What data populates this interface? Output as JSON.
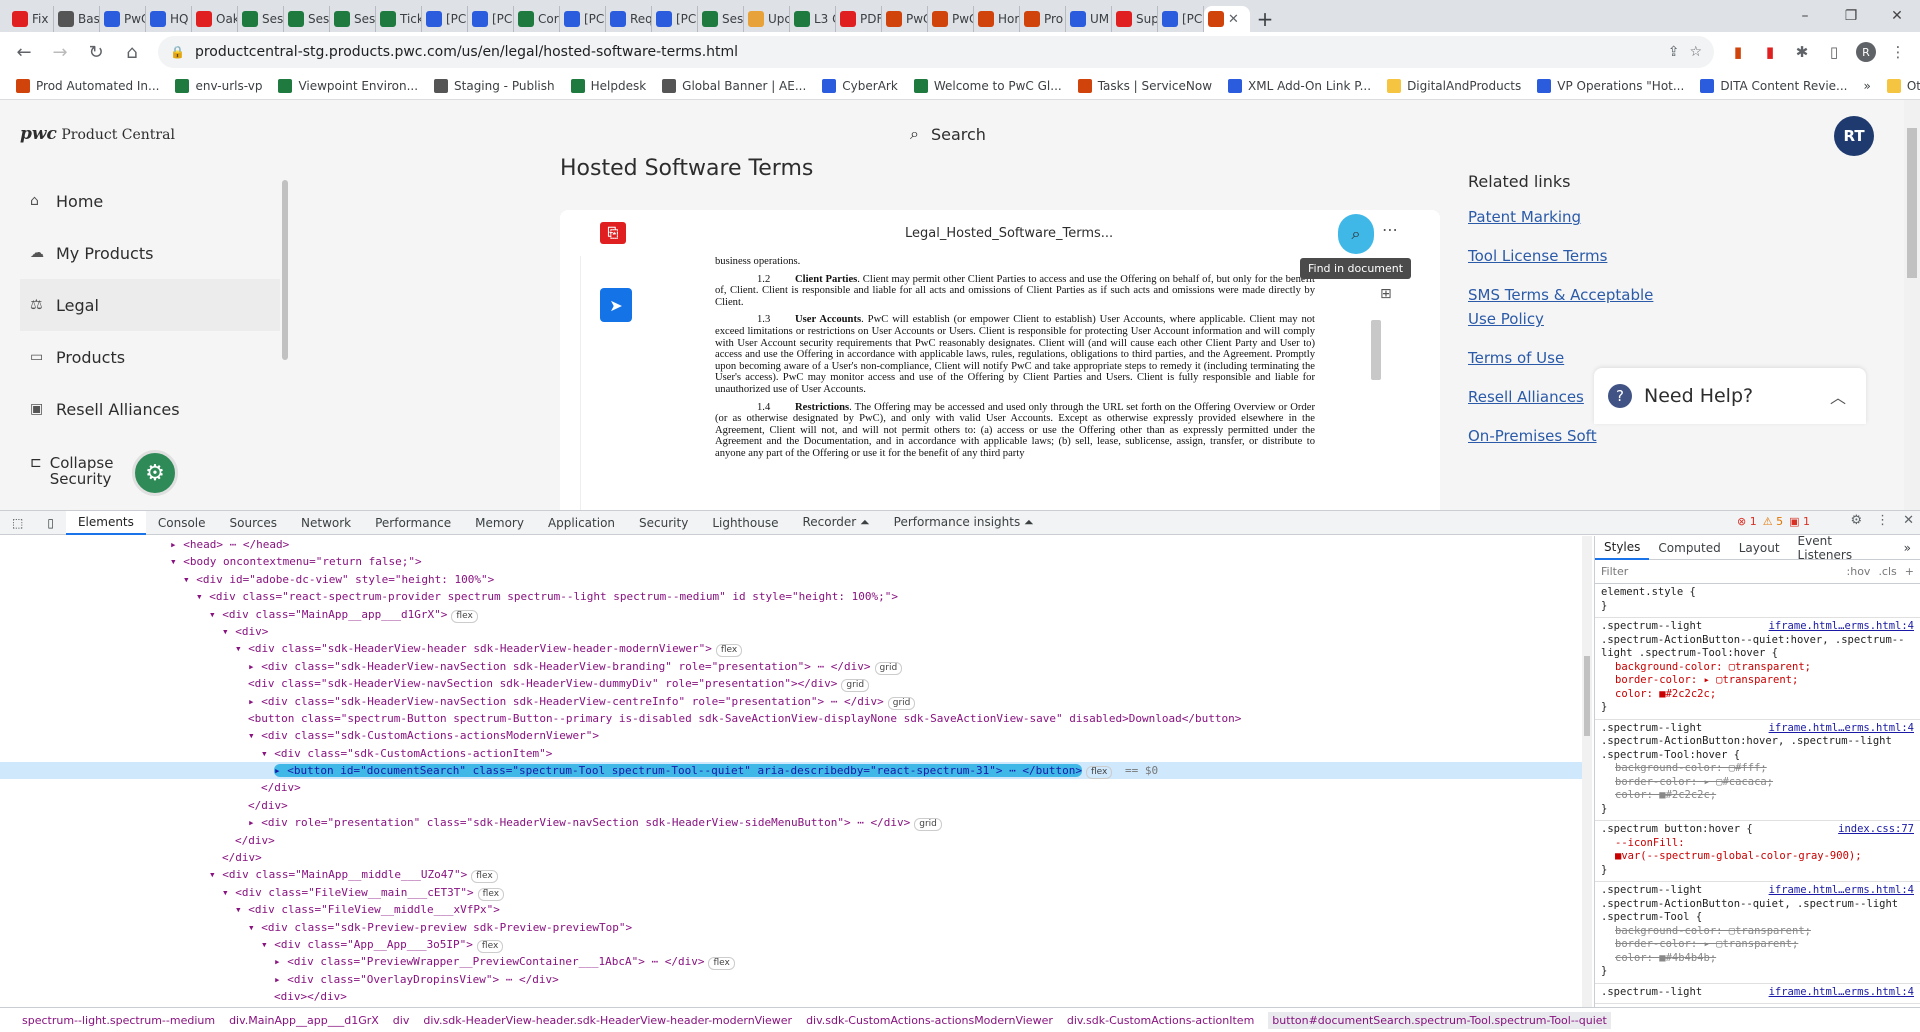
{
  "browser": {
    "tabs": [
      {
        "label": "Fix",
        "color": "#e02020"
      },
      {
        "label": "Bas",
        "color": "#555"
      },
      {
        "label": "PwC",
        "color": "#2b5cde"
      },
      {
        "label": "HQ",
        "color": "#2b5cde"
      },
      {
        "label": "Oak",
        "color": "#e02020"
      },
      {
        "label": "Ses",
        "color": "#1e7a3e"
      },
      {
        "label": "Ses",
        "color": "#1e7a3e"
      },
      {
        "label": "Ses",
        "color": "#1e7a3e"
      },
      {
        "label": "Tick",
        "color": "#1e7a3e"
      },
      {
        "label": "[PC",
        "color": "#2b5cde"
      },
      {
        "label": "[PC",
        "color": "#2b5cde"
      },
      {
        "label": "Cor",
        "color": "#1e7a3e"
      },
      {
        "label": "[PC",
        "color": "#2b5cde"
      },
      {
        "label": "Req",
        "color": "#2b5cde"
      },
      {
        "label": "[PC",
        "color": "#2b5cde"
      },
      {
        "label": "Ses",
        "color": "#1e7a3e"
      },
      {
        "label": "Upc",
        "color": "#e8a23a"
      },
      {
        "label": "L3 C",
        "color": "#1e7a3e"
      },
      {
        "label": "PDF",
        "color": "#e02020"
      },
      {
        "label": "PwC",
        "color": "#d0440c"
      },
      {
        "label": "PwC",
        "color": "#d0440c"
      },
      {
        "label": "Hor",
        "color": "#d0440c"
      },
      {
        "label": "Pro",
        "color": "#d0440c"
      },
      {
        "label": "UM",
        "color": "#2b5cde"
      },
      {
        "label": "Sup",
        "color": "#e02020"
      },
      {
        "label": "[PC",
        "color": "#2b5cde"
      }
    ],
    "active_tab_close": "✕",
    "url": "productcentral-stg.products.pwc.com/us/en/legal/hosted-software-terms.html",
    "profile_initial": "R",
    "bookmarks": [
      {
        "label": "Prod Automated In...",
        "color": "#d0440c"
      },
      {
        "label": "env-urls-vp",
        "color": "#1e7a3e"
      },
      {
        "label": "Viewpoint Environ...",
        "color": "#1e7a3e"
      },
      {
        "label": "Staging - Publish",
        "color": "#555"
      },
      {
        "label": "Helpdesk",
        "color": "#1e7a3e"
      },
      {
        "label": "Global Banner | AE...",
        "color": "#555"
      },
      {
        "label": "CyberArk",
        "color": "#2b5cde"
      },
      {
        "label": "Welcome to PwC Gl...",
        "color": "#1e7a3e"
      },
      {
        "label": "Tasks | ServiceNow",
        "color": "#d0440c"
      },
      {
        "label": "XML Add-On Link P...",
        "color": "#2b5cde"
      },
      {
        "label": "DigitalAndProducts",
        "color": "#f5c542"
      },
      {
        "label": "VP Operations \"Hot...",
        "color": "#2b5cde"
      },
      {
        "label": "DITA Content Revie...",
        "color": "#2b5cde"
      }
    ],
    "more_bookmarks": "»",
    "other_bookmarks": "Other bookmarks"
  },
  "site": {
    "logo_brand": "pwc",
    "logo_text": "Product Central",
    "search_label": "Search",
    "user_initials": "RT",
    "nav": [
      {
        "label": "Home",
        "icon": "home-icon",
        "glyph": "⌂"
      },
      {
        "label": "My Products",
        "icon": "cloud-icon",
        "glyph": "☁"
      },
      {
        "label": "Legal",
        "icon": "scale-icon",
        "glyph": "⚖"
      },
      {
        "label": "Products",
        "icon": "briefcase-icon",
        "glyph": "▭"
      },
      {
        "label": "Resell Alliances",
        "icon": "handshake-icon",
        "glyph": "▣"
      }
    ],
    "collapse_line1": "Collapse",
    "collapse_line2": "Security",
    "page_title": "Hosted Software Terms",
    "related_title": "Related links",
    "related_links": [
      "Patent Marking",
      "Tool License Terms",
      "SMS Terms & Acceptable Use Policy",
      "Terms of Use",
      "Resell Alliances",
      "On-Premises Soft"
    ],
    "need_help": "Need Help?"
  },
  "viewer": {
    "filename": "Legal_Hosted_Software_Terms...",
    "tooltip": "Find in document",
    "doc": {
      "lead": "business operations.",
      "sections": [
        {
          "num": "1.2",
          "heading": "Client Parties",
          "body": ". Client may permit other Client Parties to access and use the Offering on behalf of, but only for the benefit of, Client. Client is responsible and liable for all acts and omissions of Client Parties as if such acts and omissions were made directly by Client."
        },
        {
          "num": "1.3",
          "heading": "User Accounts",
          "body": ". PwC will establish (or empower Client to establish) User Accounts, where applicable. Client may not exceed limitations or restrictions on User Accounts or Users. Client is responsible for protecting User Account information and will comply with User Account security requirements that PwC reasonably designates. Client will (and will cause each other Client Party and User to) access and use the Offering in accordance with applicable laws, rules, regulations, obligations to third parties, and the Agreement. Promptly upon becoming aware of a User's non-compliance, Client will notify PwC and take appropriate steps to remedy it (including terminating the User's access). PwC may monitor access and use of the Offering by Client Parties and Users. Client is fully responsible and liable for unauthorized use of User Accounts."
        },
        {
          "num": "1.4",
          "heading": "Restrictions",
          "body": ". The Offering may be accessed and used only through the URL set forth on the Offering Overview or Order (or as otherwise designated by PwC), and only with valid User Accounts. Except as otherwise expressly provided elsewhere in the Agreement, Client will not, and will not permit others to: (a) access or use the Offering other than as expressly permitted under the Agreement and the Documentation, and in accordance with applicable laws; (b) sell, lease, sublicense, assign, transfer, or distribute to anyone any part of the Offering or use it for the benefit of any third party"
        }
      ]
    }
  },
  "devtools": {
    "tabs": [
      "Elements",
      "Console",
      "Sources",
      "Network",
      "Performance",
      "Memory",
      "Application",
      "Security",
      "Lighthouse",
      "Recorder ⏶",
      "Performance insights ⏶"
    ],
    "errors": "1",
    "warnings": "5",
    "issues": "1",
    "dom_lines": [
      {
        "indent": 0,
        "text": "▸ <head> ⋯ </head>"
      },
      {
        "indent": 0,
        "text": "▾ <body oncontextmenu=\"return false;\">"
      },
      {
        "indent": 1,
        "text": "▾ <div id=\"adobe-dc-view\" style=\"height: 100%\">"
      },
      {
        "indent": 2,
        "text": "▾ <div class=\"react-spectrum-provider spectrum spectrum--light spectrum--medium\" id style=\"height: 100%;\">"
      },
      {
        "indent": 3,
        "text": "▾ <div class=\"MainApp__app___d1GrX\">",
        "badge": "flex"
      },
      {
        "indent": 4,
        "text": "▾ <div>"
      },
      {
        "indent": 5,
        "text": "▾ <div class=\"sdk-HeaderView-header sdk-HeaderView-header-modernViewer\">",
        "badge": "flex"
      },
      {
        "indent": 6,
        "text": "▸ <div class=\"sdk-HeaderView-navSection sdk-HeaderView-branding\" role=\"presentation\"> ⋯ </div>",
        "badge": "grid"
      },
      {
        "indent": 6,
        "text": "  <div class=\"sdk-HeaderView-navSection sdk-HeaderView-dummyDiv\" role=\"presentation\"></div>",
        "badge": "grid"
      },
      {
        "indent": 6,
        "text": "▸ <div class=\"sdk-HeaderView-navSection sdk-HeaderView-centreInfo\" role=\"presentation\"> ⋯ </div>",
        "badge": "grid"
      },
      {
        "indent": 6,
        "text": "  <button class=\"spectrum-Button spectrum-Button--primary is-disabled sdk-SaveActionView-displayNone sdk-SaveActionView-save\" disabled>Download</button>"
      },
      {
        "indent": 6,
        "text": "▾ <div class=\"sdk-CustomActions-actionsModernViewer\">"
      },
      {
        "indent": 7,
        "text": "▾ <div class=\"sdk-CustomActions-actionItem\">"
      },
      {
        "indent": 8,
        "text": "▸ <button id=\"documentSearch\" class=\"spectrum-Tool spectrum-Tool--quiet\" aria-describedby=\"react-spectrum-31\"> ⋯ </button>",
        "badge": "flex",
        "selected": true,
        "suffix": "== $0"
      },
      {
        "indent": 7,
        "text": "  </div>"
      },
      {
        "indent": 6,
        "text": "  </div>"
      },
      {
        "indent": 6,
        "text": "▸ <div role=\"presentation\" class=\"sdk-HeaderView-navSection sdk-HeaderView-sideMenuButton\"> ⋯ </div>",
        "badge": "grid"
      },
      {
        "indent": 5,
        "text": "  </div>"
      },
      {
        "indent": 4,
        "text": "  </div>"
      },
      {
        "indent": 3,
        "text": "▾ <div class=\"MainApp__middle___UZo47\">",
        "badge": "flex"
      },
      {
        "indent": 4,
        "text": "▾ <div class=\"FileView__main___cET3T\">",
        "badge": "flex"
      },
      {
        "indent": 5,
        "text": "▾ <div class=\"FileView__middle___xVfPx\">"
      },
      {
        "indent": 6,
        "text": "▾ <div class=\"sdk-Preview-preview sdk-Preview-previewTop\">"
      },
      {
        "indent": 7,
        "text": "▾ <div class=\"App__App___3o5IP\">",
        "badge": "flex"
      },
      {
        "indent": 8,
        "text": "▸ <div class=\"PreviewWrapper__PreviewContainer___1AbcA\"> ⋯ </div>",
        "badge": "flex"
      },
      {
        "indent": 8,
        "text": "▸ <div class=\"OverlayDropinsView\"> ⋯ </div>"
      },
      {
        "indent": 8,
        "text": "  <div></div>"
      }
    ],
    "styles_tabs": [
      "Styles",
      "Computed",
      "Layout",
      "Event Listeners",
      "»"
    ],
    "filter_placeholder": "Filter",
    "filter_hov": ":hov",
    "filter_cls": ".cls",
    "rules": [
      {
        "selector": "element.style {",
        "src": "",
        "props": [],
        "close": "}"
      },
      {
        "selector": ".spectrum--light .spectrum-ActionButton--quiet:hover, .spectrum--light .spectrum-Tool:hover {",
        "src": "iframe.html…erms.html:4",
        "props": [
          {
            "t": "background-color: ▢transparent;"
          },
          {
            "t": "border-color: ▸ ▢transparent;"
          },
          {
            "t": "color: ■#2c2c2c;"
          }
        ],
        "close": "}"
      },
      {
        "selector": ".spectrum--light .spectrum-ActionButton:hover, .spectrum--light .spectrum-Tool:hover {",
        "src": "iframe.html…erms.html:4",
        "props": [
          {
            "t": "background-color: ▢#fff;",
            "strike": true
          },
          {
            "t": "border-color: ▸ ▢#cacaca;",
            "strike": true
          },
          {
            "t": "color: ■#2c2c2c;",
            "strike": true
          }
        ],
        "close": "}"
      },
      {
        "selector": ".spectrum button:hover {",
        "src": "index.css:77",
        "props": [
          {
            "t": "--iconFill:"
          },
          {
            "t": "  ■var(--spectrum-global-color-gray-900);"
          }
        ],
        "close": "}"
      },
      {
        "selector": ".spectrum--light .spectrum-ActionButton--quiet, .spectrum--light .spectrum-Tool {",
        "src": "iframe.html…erms.html:4",
        "props": [
          {
            "t": "background-color: ▢transparent;",
            "strike": true
          },
          {
            "t": "border-color: ▸ ▢transparent;",
            "strike": true
          },
          {
            "t": "color: ■#4b4b4b;",
            "strike": true
          }
        ],
        "close": "}"
      },
      {
        "selector": ".spectrum--light",
        "src": "iframe.html…erms.html:4",
        "props": [],
        "close": ""
      }
    ],
    "breadcrumbs": [
      "spectrum--light.spectrum--medium",
      "div.MainApp__app___d1GrX",
      "div",
      "div.sdk-HeaderView-header.sdk-HeaderView-header-modernViewer",
      "div.sdk-CustomActions-actionsModernViewer",
      "div.sdk-CustomActions-actionItem",
      "button#documentSearch.spectrum-Tool.spectrum-Tool--quiet"
    ]
  }
}
